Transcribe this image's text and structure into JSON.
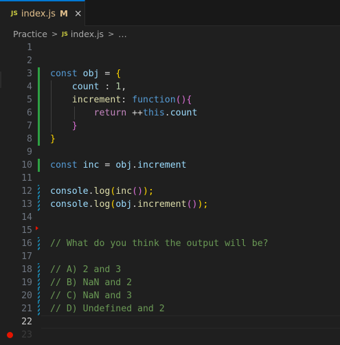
{
  "tab": {
    "badge": "JS",
    "filename": "index.js",
    "modified": "M",
    "close": "×"
  },
  "breadcrumb": {
    "folder": "Practice",
    "badge": "JS",
    "file": "index.js",
    "more": "…"
  },
  "lines": {
    "n1": "1",
    "n2": "2",
    "n3": "3",
    "n4": "4",
    "n5": "5",
    "n6": "6",
    "n7": "7",
    "n8": "8",
    "n9": "9",
    "n10": "10",
    "n11": "11",
    "n12": "12",
    "n13": "13",
    "n14": "14",
    "n15": "15",
    "n16": "16",
    "n17": "17",
    "n18": "18",
    "n19": "19",
    "n20": "20",
    "n21": "21",
    "n22": "22",
    "n23": "23"
  },
  "code": {
    "l3": {
      "kw": "const",
      "name": "obj",
      "op": " = ",
      "br": "{"
    },
    "l4": {
      "prop": "count",
      "op": " : ",
      "num": "1",
      "comma": ","
    },
    "l5": {
      "prop": "increment",
      "op": ": ",
      "kw": "function",
      "paren": "()",
      "br": "{"
    },
    "l6": {
      "kw": "return",
      "op": " ++",
      "this": "this",
      "dot": ".",
      "prop": "count"
    },
    "l7": {
      "br": "}"
    },
    "l8": {
      "br": "}"
    },
    "l10": {
      "kw": "const",
      "name": "inc",
      "op": " = ",
      "obj": "obj",
      "dot": ".",
      "prop": "increment"
    },
    "l12": {
      "obj": "console",
      "dot": ".",
      "fn": "log",
      "p1": "(",
      "call": "inc",
      "p2": "()",
      "p3": ");"
    },
    "l13": {
      "obj": "console",
      "dot": ".",
      "fn": "log",
      "p1": "(",
      "obj2": "obj",
      "dot2": ".",
      "call": "increment",
      "p2": "()",
      "p3": ");"
    },
    "l16": "// What do you think the output will be?",
    "l18": "// A) 2 and 3",
    "l19": "// B) NaN and 2",
    "l20": "// C) NaN and 3",
    "l21": "// D) Undefined and 2"
  },
  "colors": {
    "accent": "#0078d4",
    "breakpoint": "#e51400",
    "added": "#2ea043",
    "modified": "#1b81a8"
  }
}
